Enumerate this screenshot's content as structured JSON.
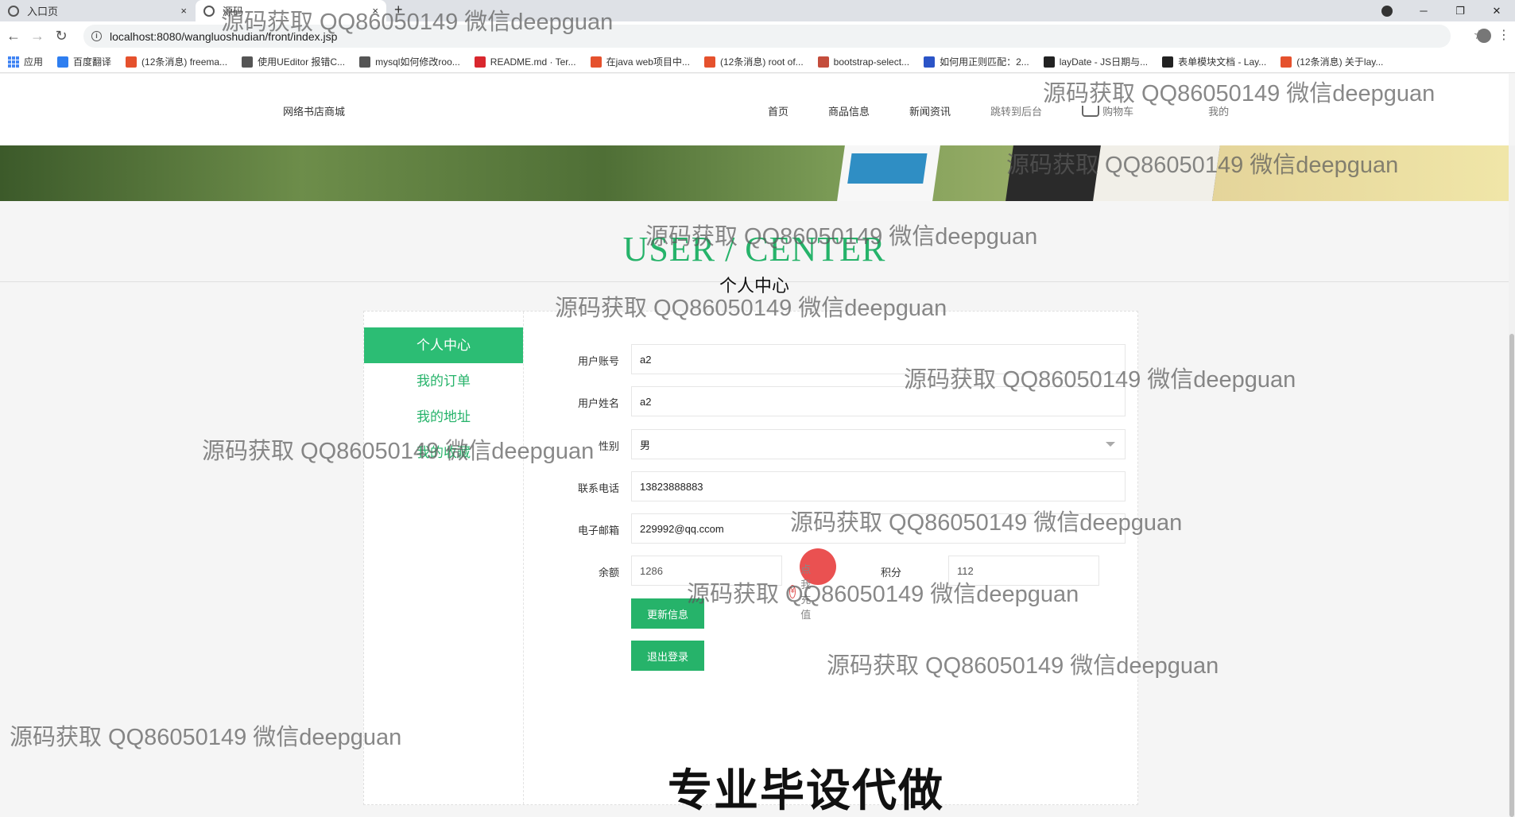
{
  "browser": {
    "tabs": [
      {
        "title": "入口页",
        "close": "×"
      },
      {
        "title": "源码",
        "close": "×"
      }
    ],
    "new_tab": "+",
    "url": "localhost:8080/wangluoshudian/front/index.jsp",
    "bookmarks": [
      {
        "label": "应用",
        "color": "#4285f4"
      },
      {
        "label": "百度翻译",
        "color": "#2e7ef0"
      },
      {
        "label": "(12条消息) freema...",
        "color": "#e5512d"
      },
      {
        "label": "使用UEditor 报错C...",
        "color": "#555555"
      },
      {
        "label": "mysql如何修改roo...",
        "color": "#555555"
      },
      {
        "label": "README.md · Ter...",
        "color": "#d9272e"
      },
      {
        "label": "在java web项目中...",
        "color": "#e5512d"
      },
      {
        "label": "(12条消息) root of...",
        "color": "#e5512d"
      },
      {
        "label": "bootstrap-select...",
        "color": "#c44d3c"
      },
      {
        "label": "如何用正则匹配：2...",
        "color": "#2b54c7"
      },
      {
        "label": "layDate - JS日期与...",
        "color": "#222222"
      },
      {
        "label": "表单模块文档 - Lay...",
        "color": "#222222"
      },
      {
        "label": "(12条消息) 关于lay...",
        "color": "#e5512d"
      }
    ]
  },
  "site": {
    "logo": "网络书店商城",
    "nav": [
      {
        "label": "首页"
      },
      {
        "label": "商品信息"
      },
      {
        "label": "新闻资讯"
      },
      {
        "label": "跳转到后台"
      }
    ],
    "cart": "购物车",
    "mine": "我的"
  },
  "user_center": {
    "title_en": "USER / CENTER",
    "title_cn": "个人中心",
    "sidebar": [
      {
        "label": "个人中心"
      },
      {
        "label": "我的订单"
      },
      {
        "label": "我的地址"
      },
      {
        "label": "我的收藏"
      }
    ],
    "form": {
      "account_label": "用户账号",
      "account_value": "a2",
      "name_label": "用户姓名",
      "name_value": "a2",
      "gender_label": "性别",
      "gender_value": "男",
      "phone_label": "联系电话",
      "phone_value": "13823888883",
      "email_label": "电子邮箱",
      "email_value": "229992@qq.ccom",
      "balance_label": "余额",
      "balance_value": "1286",
      "recharge_icon": "¥",
      "recharge_label": "点我充值",
      "points_label": "积分",
      "points_value": "112",
      "update_button": "更新信息",
      "logout_button": "退出登录"
    }
  },
  "watermark": "源码获取 QQ86050149 微信deepguan",
  "big_watermark": "专业毕设代做",
  "colors": {
    "accent": "#26b36a",
    "active_bg": "#2cbd74",
    "click_indicator": "#e63232"
  }
}
